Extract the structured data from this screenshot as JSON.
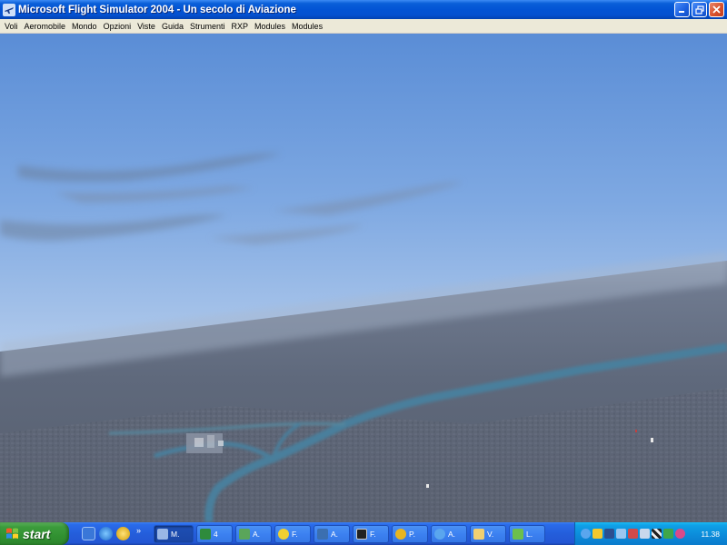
{
  "window": {
    "title": "Microsoft Flight Simulator 2004 - Un secolo di Aviazione",
    "icon": "airplane-icon",
    "controls": [
      "minimize",
      "restore",
      "close"
    ]
  },
  "menu": {
    "items": [
      "Voli",
      "Aeromobile",
      "Mondo",
      "Opzioni",
      "Viste",
      "Guida",
      "Strumenti",
      "RXP",
      "Modules",
      "Modules"
    ]
  },
  "scene": {
    "description_icon": "3d-scenery-view",
    "colors": {
      "sky_top": "#5b8ed6",
      "sky_horizon": "#c9dbf0",
      "ground": "#5d6778",
      "river": "#3f7a98"
    }
  },
  "taskbar": {
    "start_label": "start",
    "quicklaunch": [
      "outlook-express-icon",
      "internet-explorer-icon",
      "media-player-icon"
    ],
    "chevron": "»",
    "tasks": [
      {
        "label": "M.",
        "icon": "airplane-icon",
        "active": true
      },
      {
        "label": "4",
        "icon": "excel-icon",
        "active": false
      },
      {
        "label": "A.",
        "icon": "globe-icon",
        "active": false
      },
      {
        "label": "F.",
        "icon": "fs-icon",
        "active": false
      },
      {
        "label": "A.",
        "icon": "app-icon",
        "active": false
      },
      {
        "label": "F.",
        "icon": "monitor-icon",
        "active": false
      },
      {
        "label": "P.",
        "icon": "player-icon",
        "active": false
      },
      {
        "label": "A.",
        "icon": "internet-explorer-icon",
        "active": false
      },
      {
        "label": "V.",
        "icon": "folder-icon",
        "active": false
      },
      {
        "label": "L.",
        "icon": "network-icon",
        "active": false
      }
    ],
    "clock": "11.38"
  }
}
